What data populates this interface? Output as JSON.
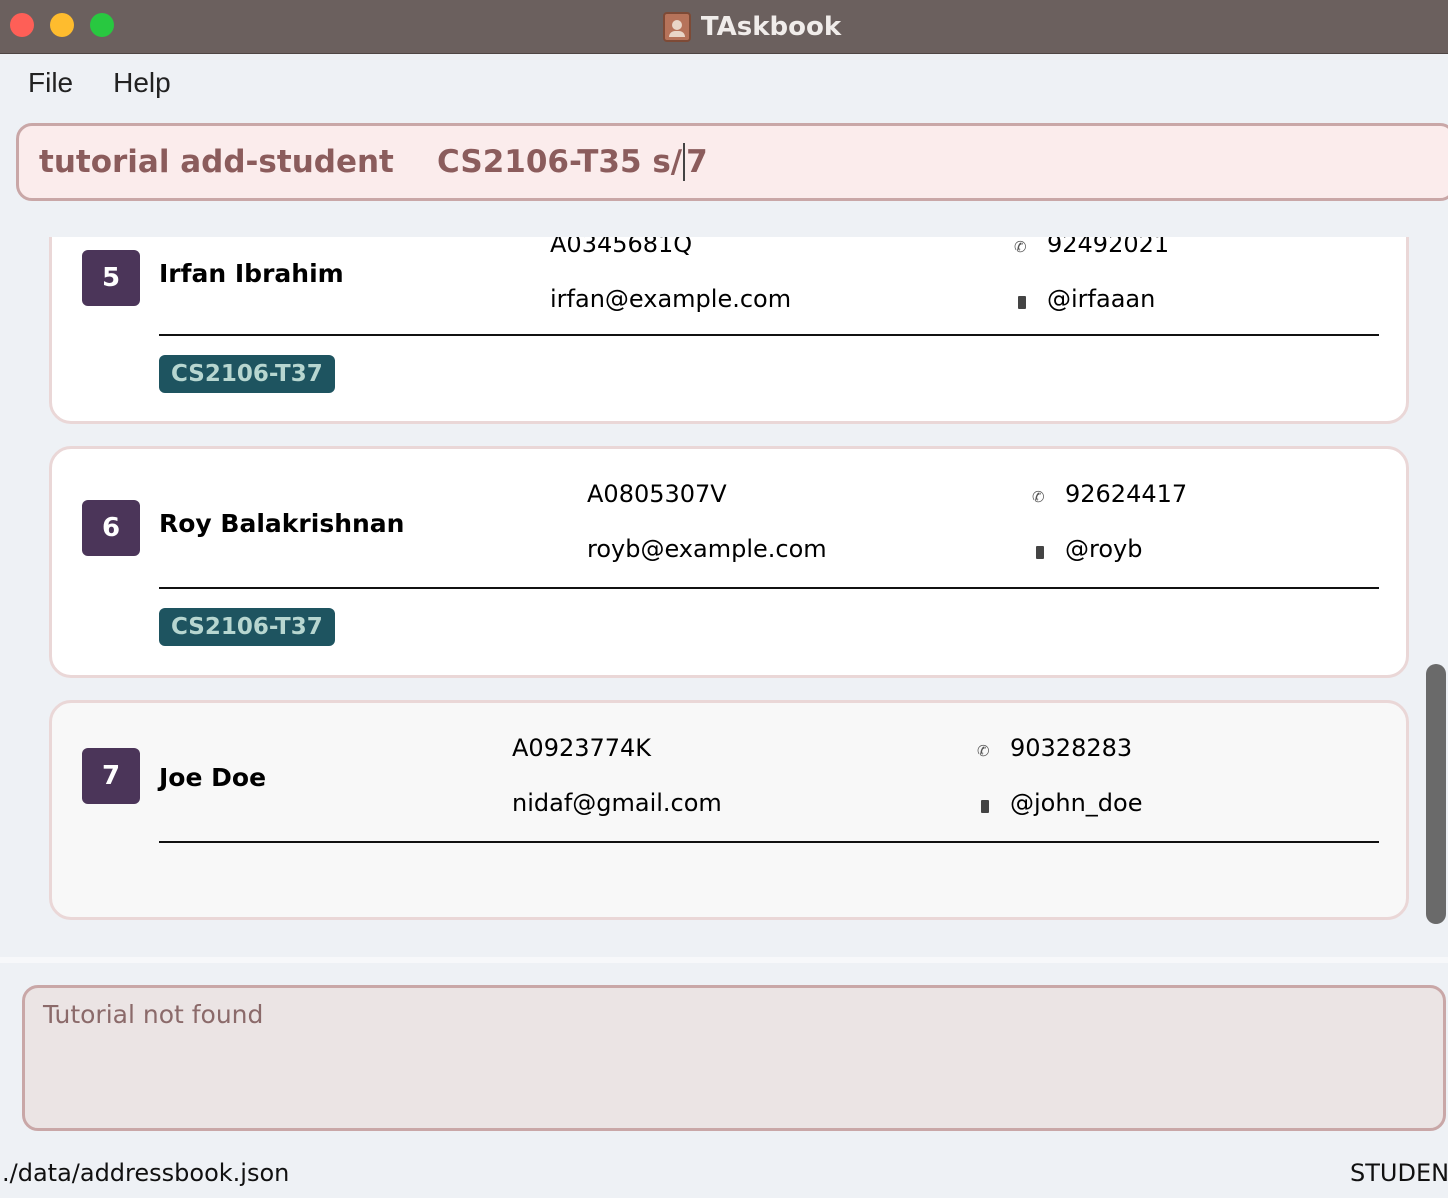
{
  "window": {
    "title": "TAskbook",
    "icon": "address-book-icon"
  },
  "menu": {
    "items": [
      {
        "label": "File"
      },
      {
        "label": "Help"
      }
    ]
  },
  "command": {
    "text_before_caret": "tutorial add-student    CS2106-T35 s/",
    "text_after_caret": "7"
  },
  "students": [
    {
      "index": "5",
      "name": "Irfan Ibrahim",
      "student_id": "A0345681Q",
      "email": "irfan@example.com",
      "phone": "92492021",
      "telegram": "@irfaaan",
      "tags": [
        "CS2106-T37"
      ]
    },
    {
      "index": "6",
      "name": "Roy Balakrishnan",
      "student_id": "A0805307V",
      "email": "royb@example.com",
      "phone": "92624417",
      "telegram": "@royb",
      "tags": [
        "CS2106-T37"
      ]
    },
    {
      "index": "7",
      "name": "Joe Doe",
      "student_id": "A0923774K",
      "email": "nidaf@gmail.com",
      "phone": "90328283",
      "telegram": "@john_doe",
      "tags": []
    }
  ],
  "result": {
    "message": "Tutorial not found"
  },
  "status": {
    "file_path": "./data/addressbook.json",
    "mode": "STUDEN"
  },
  "colors": {
    "title_bar": "#6b605e",
    "index_badge": "#4b3559",
    "tag": "#1e5460",
    "command_text": "#8b5c5c"
  }
}
